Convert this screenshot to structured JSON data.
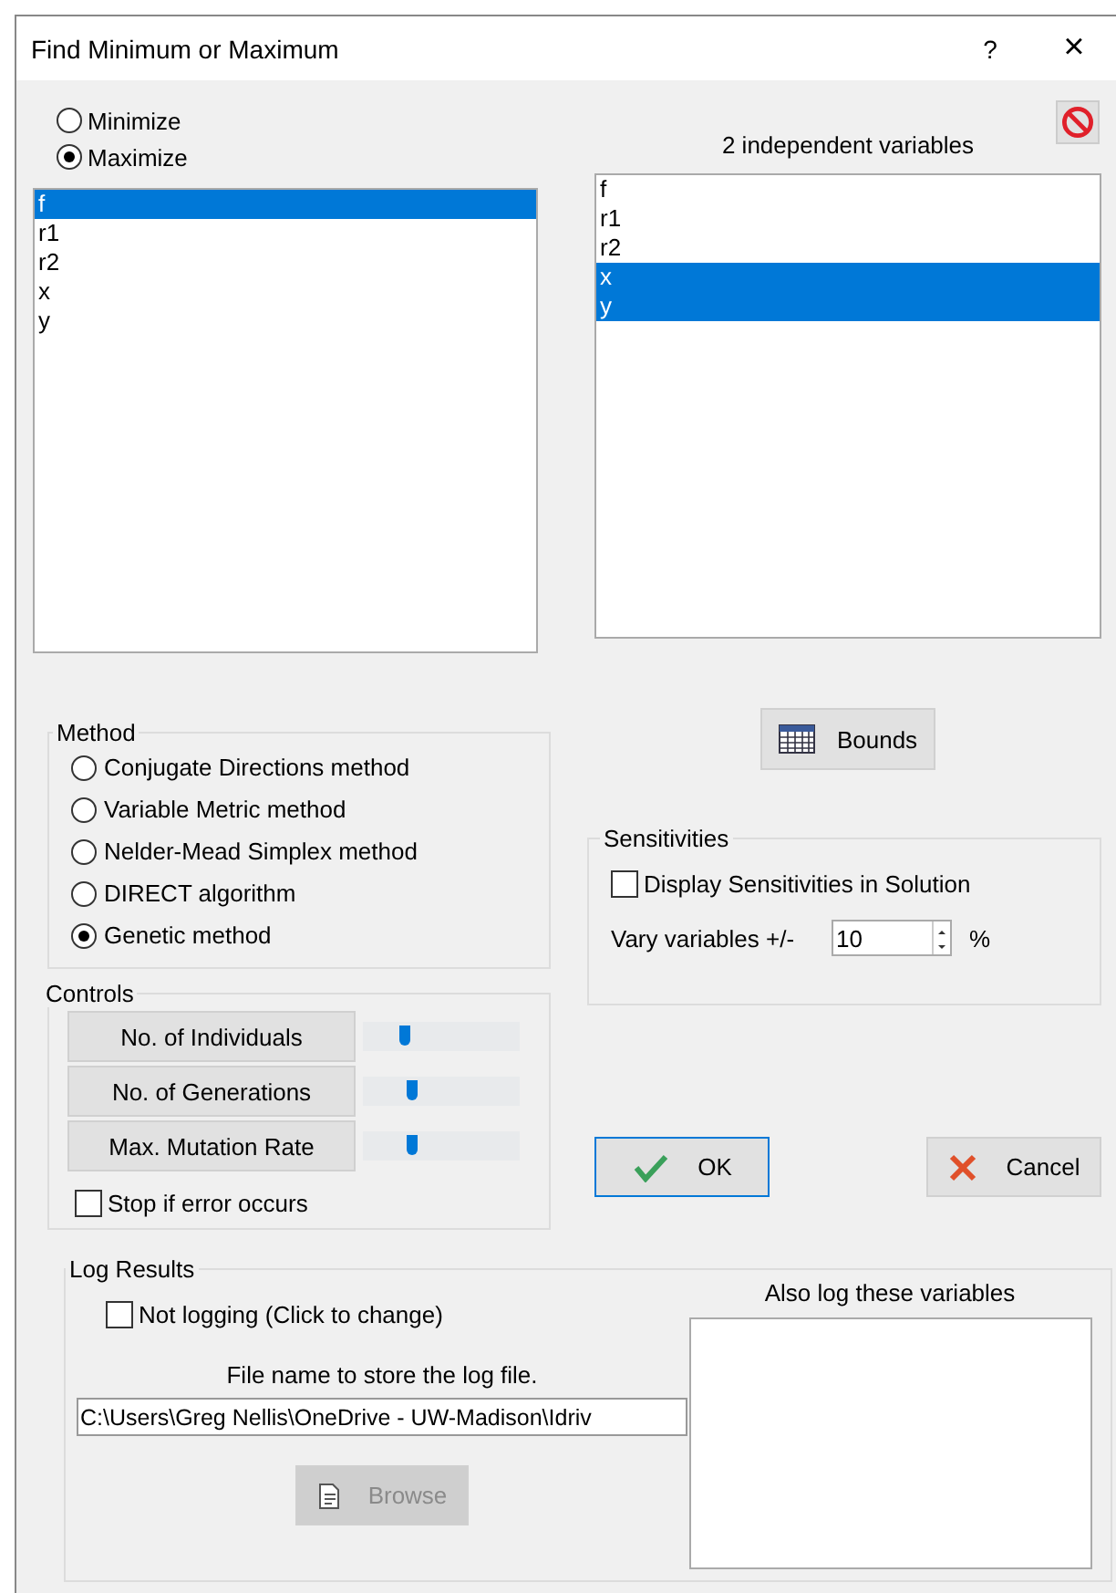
{
  "window": {
    "title": "Find Minimum or Maximum",
    "help": "?",
    "close": "×"
  },
  "objective": [
    {
      "label": "Minimize",
      "selected": false
    },
    {
      "label": "Maximize",
      "selected": true
    }
  ],
  "objective_list": [
    {
      "label": "f",
      "selected": true
    },
    {
      "label": "r1",
      "selected": false
    },
    {
      "label": "r2",
      "selected": false
    },
    {
      "label": "x",
      "selected": false
    },
    {
      "label": "y",
      "selected": false
    }
  ],
  "independent": {
    "heading": "2 independent variables",
    "items": [
      {
        "label": "f",
        "selected": false
      },
      {
        "label": "r1",
        "selected": false
      },
      {
        "label": "r2",
        "selected": false
      },
      {
        "label": "x",
        "selected": true
      },
      {
        "label": "y",
        "selected": true
      }
    ]
  },
  "method": {
    "title": "Method",
    "options": [
      {
        "label": "Conjugate Directions method",
        "selected": false
      },
      {
        "label": "Variable Metric method",
        "selected": false
      },
      {
        "label": "Nelder-Mead Simplex method",
        "selected": false
      },
      {
        "label": "DIRECT algorithm",
        "selected": false
      },
      {
        "label": "Genetic method",
        "selected": true
      }
    ]
  },
  "bounds_button": "Bounds",
  "sensitivities": {
    "title": "Sensitivities",
    "display": {
      "label": "Display Sensitivities in Solution",
      "checked": false
    },
    "vary_label": "Vary variables +/-",
    "vary_value": "10",
    "unit": "%"
  },
  "controls": {
    "title": "Controls",
    "sliders": [
      {
        "label": "No. of Individuals",
        "level": 0.25
      },
      {
        "label": "No. of Generations",
        "level": 0.3
      },
      {
        "label": "Max. Mutation Rate",
        "level": 0.3
      }
    ],
    "stop_on_error": {
      "label": "Stop if error occurs",
      "checked": false
    }
  },
  "ok_button": "OK",
  "cancel_button": "Cancel",
  "log": {
    "title": "Log Results",
    "logging": {
      "label": "Not logging (Click to change)",
      "checked": false
    },
    "file_label": "File name to store the log file.",
    "file_path": "C:\\Users\\Greg Nellis\\OneDrive - UW-Madison\\Idriv",
    "browse": {
      "label": "Browse",
      "disabled": true
    },
    "also_heading": "Also log these variables"
  }
}
